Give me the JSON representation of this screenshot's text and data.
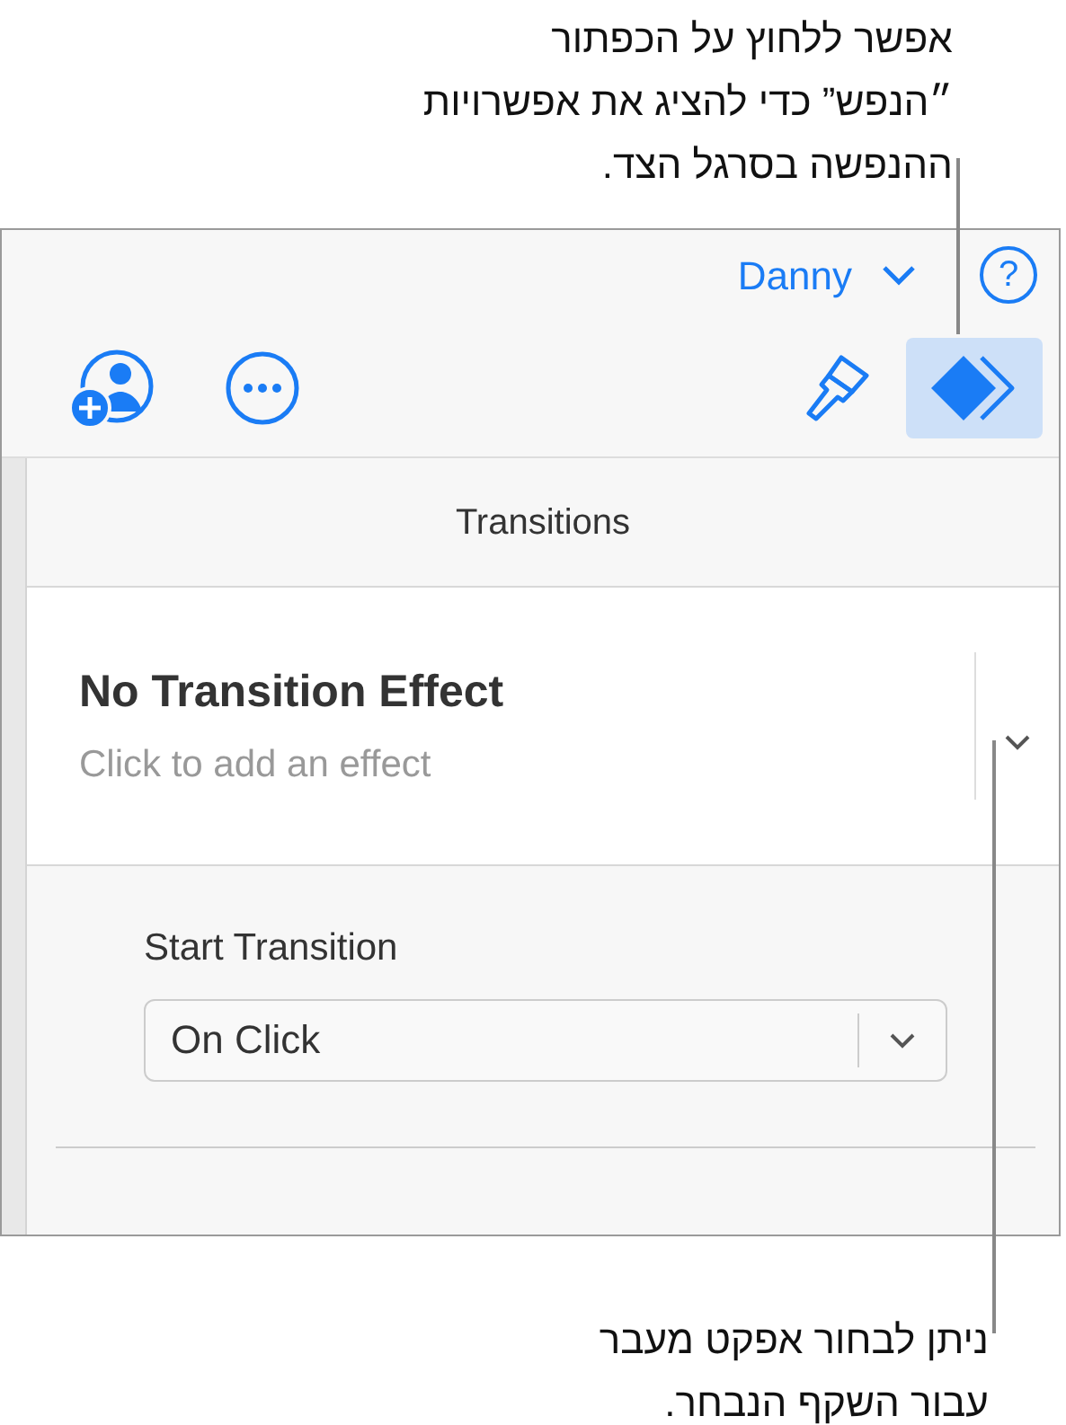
{
  "callouts": [
    {
      "kind": "top",
      "lines": [
        "אפשר ללחוץ על הכפתור",
        "״הנפש” כדי להציג את אפשרויות",
        "ההנפשה בסרגל הצד."
      ]
    },
    {
      "kind": "bottom",
      "lines": [
        "ניתן לבחור אפקט מעבר",
        "עבור השקף הנבחר."
      ]
    }
  ],
  "account": {
    "user": "Danny",
    "help": "?"
  },
  "toolbar": [
    {
      "kind": "collaborate",
      "selected": false
    },
    {
      "kind": "more",
      "selected": false
    },
    {
      "kind": "format",
      "selected": false
    },
    {
      "kind": "animate",
      "selected": true
    }
  ],
  "section_title": "Transitions",
  "effect": {
    "title": "No Transition Effect",
    "subtitle": "Click to add an effect"
  },
  "start": {
    "label": "Start Transition",
    "value": "On Click"
  }
}
